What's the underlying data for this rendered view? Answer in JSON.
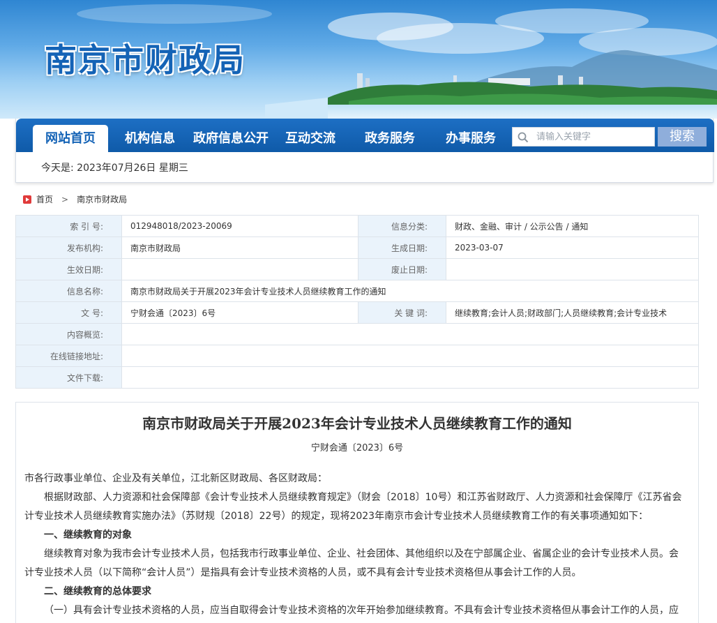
{
  "site": {
    "title": "南京市财政局"
  },
  "nav": {
    "items": [
      {
        "label": "网站首页",
        "active": true
      },
      {
        "label": "机构信息"
      },
      {
        "label": "政府信息公开"
      },
      {
        "label": "互动交流"
      },
      {
        "label": "政务服务"
      },
      {
        "label": "办事服务"
      }
    ],
    "search_placeholder": "请输入关键字",
    "search_button": "搜索"
  },
  "date_line": "今天是: 2023年07月26日 星期三",
  "breadcrumb": {
    "home": "首页",
    "current": "南京市财政局"
  },
  "info": {
    "index_label": "索  引  号:",
    "index_value": "012948018/2023-20069",
    "category_label": "信息分类:",
    "category_value": "财政、金融、审计 / 公示公告 / 通知",
    "publisher_label": "发布机构:",
    "publisher_value": "南京市财政局",
    "created_label": "生成日期:",
    "created_value": "2023-03-07",
    "effective_label": "生效日期:",
    "effective_value": "",
    "abolish_label": "废止日期:",
    "abolish_value": "",
    "name_label": "信息名称:",
    "name_value": "南京市财政局关于开展2023年会计专业技术人员继续教育工作的通知",
    "docno_label": "文      号:",
    "docno_value": "宁财会通〔2023〕6号",
    "keywords_label": "关  键  词:",
    "keywords_value": "继续教育;会计人员;财政部门;人员继续教育;会计专业技术",
    "summary_label": "内容概览:",
    "summary_value": "",
    "link_label": "在线链接地址:",
    "link_value": "",
    "download_label": "文件下载:",
    "download_value": ""
  },
  "article": {
    "title": "南京市财政局关于开展2023年会计专业技术人员继续教育工作的通知",
    "doc_no": "宁财会通〔2023〕6号",
    "greeting": "市各行政事业单位、企业及有关单位，江北新区财政局、各区财政局：",
    "para1": "根据财政部、人力资源和社会保障部《会计专业技术人员继续教育规定》（财会〔2018〕10号）和江苏省财政厅、人力资源和社会保障厅《江苏省会计专业技术人员继续教育实施办法》（苏财规〔2018〕22号）的规定，现将2023年南京市会计专业技术人员继续教育工作的有关事项通知如下：",
    "heading1": "一、继续教育的对象",
    "para2": "继续教育对象为我市会计专业技术人员，包括我市行政事业单位、企业、社会团体、其他组织以及在宁部属企业、省属企业的会计专业技术人员。会计专业技术人员（以下简称“会计人员”）是指具有会计专业技术资格的人员，或不具有会计专业技术资格但从事会计工作的人员。",
    "heading2": "二、继续教育的总体要求",
    "para3": "（一）具有会计专业技术资格的人员，应当自取得会计专业技术资格的次年开始参加继续教育。不具有会计专业技术资格但从事会计工作的人员，应"
  },
  "colors": {
    "nav_blue": "#1463b6",
    "label_bg": "#eaf3fb",
    "search_btn": "#8faedb"
  }
}
